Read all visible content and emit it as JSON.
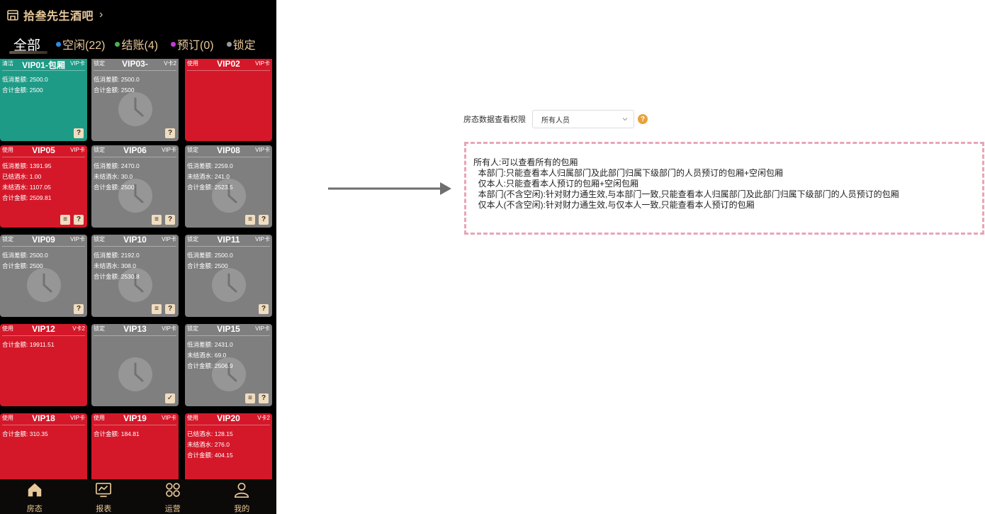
{
  "store": {
    "name": "拾叁先生酒吧",
    "chevron": "›"
  },
  "tabs": [
    {
      "label": "全部",
      "dot": ""
    },
    {
      "label": "空闲(22)",
      "dot": "#2e8be0"
    },
    {
      "label": "结账(4)",
      "dot": "#4caf50"
    },
    {
      "label": "预订(0)",
      "dot": "#c23bd4"
    },
    {
      "label": "锁定",
      "dot": "#9a9a9a"
    }
  ],
  "rooms": [
    {
      "name": "VIP01-包厢",
      "status": "清洁",
      "card": "VIP卡",
      "color": "teal",
      "lines": [
        "低消差额: 2500.0",
        "合计金额: 2500"
      ],
      "clock": false,
      "badges": [
        "?"
      ]
    },
    {
      "name": "VIP03-",
      "status": "锁定",
      "card": "V卡2",
      "color": "gray",
      "lines": [
        "低消差额: 2500.0",
        "合计金额: 2500"
      ],
      "clock": true,
      "badges": [
        "?"
      ]
    },
    {
      "name": "VIP02",
      "status": "使用",
      "card": "VIP卡",
      "color": "red",
      "lines": [],
      "clock": false,
      "badges": []
    },
    {
      "name": "VIP05",
      "status": "使用",
      "card": "VIP卡",
      "color": "red",
      "lines": [
        "低消差额: 1391.95",
        "已结酒水: 1.00",
        "未结酒水: 1107.05",
        "合计金额: 2509.81"
      ],
      "clock": false,
      "badges": [
        "≡",
        "?"
      ]
    },
    {
      "name": "VIP06",
      "status": "锁定",
      "card": "VIP卡",
      "color": "gray",
      "lines": [
        "低消差额: 2470.0",
        "未结酒水: 30.0",
        "合计金额: 2500"
      ],
      "clock": true,
      "badges": [
        "≡",
        "?"
      ]
    },
    {
      "name": "VIP08",
      "status": "锁定",
      "card": "VIP卡",
      "color": "gray",
      "lines": [
        "低消差额: 2259.0",
        "未结酒水: 241.0",
        "合计金额: 2523.5"
      ],
      "clock": true,
      "badges": [
        "≡",
        "?"
      ]
    },
    {
      "name": "VIP09",
      "status": "锁定",
      "card": "VIP卡",
      "color": "gray",
      "lines": [
        "低消差额: 2500.0",
        "合计金额: 2500"
      ],
      "clock": true,
      "badges": [
        "?"
      ]
    },
    {
      "name": "VIP10",
      "status": "锁定",
      "card": "VIP卡",
      "color": "gray",
      "lines": [
        "低消差额: 2192.0",
        "未结酒水: 308.0",
        "合计金额: 2530.8"
      ],
      "clock": true,
      "badges": [
        "≡",
        "?"
      ]
    },
    {
      "name": "VIP11",
      "status": "锁定",
      "card": "VIP卡",
      "color": "gray",
      "lines": [
        "低消差额: 2500.0",
        "合计金额: 2500"
      ],
      "clock": true,
      "badges": [
        "?"
      ]
    },
    {
      "name": "VIP12",
      "status": "使用",
      "card": "V卡2",
      "color": "red",
      "lines": [
        "合计金额: 19911.51"
      ],
      "clock": false,
      "badges": []
    },
    {
      "name": "VIP13",
      "status": "锁定",
      "card": "VIP卡",
      "color": "gray",
      "lines": [],
      "clock": true,
      "badges": [
        "✓"
      ]
    },
    {
      "name": "VIP15",
      "status": "锁定",
      "card": "VIP卡",
      "color": "gray",
      "lines": [
        "低消差额: 2431.0",
        "未结酒水: 69.0",
        "合计金额: 2506.9"
      ],
      "clock": true,
      "badges": [
        "≡",
        "?"
      ]
    },
    {
      "name": "VIP18",
      "status": "使用",
      "card": "VIP卡",
      "color": "red",
      "lines": [
        "合计金额: 310.35"
      ],
      "clock": false,
      "badges": []
    },
    {
      "name": "VIP19",
      "status": "使用",
      "card": "VIP卡",
      "color": "red",
      "lines": [
        "合计金额: 184.81"
      ],
      "clock": false,
      "badges": []
    },
    {
      "name": "VIP20",
      "status": "使用",
      "card": "V卡2",
      "color": "red",
      "lines": [
        "已结酒水: 128.15",
        "未结酒水: 276.0",
        "合计金额: 404.15"
      ],
      "clock": false,
      "badges": []
    }
  ],
  "nav": [
    {
      "label": "房态",
      "icon": "home-icon"
    },
    {
      "label": "报表",
      "icon": "monitor-chart-icon"
    },
    {
      "label": "运营",
      "icon": "grid-apps-icon"
    },
    {
      "label": "我的",
      "icon": "user-icon"
    }
  ],
  "permission": {
    "label": "房态数据查看权限",
    "selected": "所有人员",
    "help": "?"
  },
  "notes": [
    "所有人:可以查看所有的包厢",
    "  本部门:只能查看本人归属部门及此部门归属下级部门的人员预订的包厢+空闲包厢",
    "  仅本人:只能查看本人预订的包厢+空闲包厢",
    "  本部门(不含空闲):针对财力通生效,与本部门一致,只能查看本人归属部门及此部门归属下级部门的人员预订的包厢",
    "  仅本人(不含空闲):针对财力通生效,与仅本人一致,只能查看本人预订的包厢"
  ],
  "colors": {
    "red": "#d4182a",
    "gray": "#7f7f7f",
    "teal": "#1e9b86",
    "gold": "#e8c89a",
    "note_border": "#eaa4b6",
    "help": "#e8a23a"
  }
}
